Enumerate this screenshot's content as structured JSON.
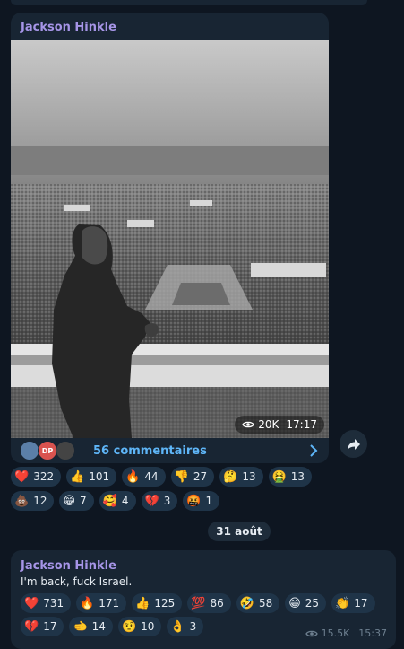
{
  "posts": [
    {
      "sender": "Jackson Hinkle",
      "image_icon": "photo-crowd-balcony",
      "views": "20K",
      "time": "17:17",
      "avatar_initials": "DP",
      "comments_label": "56 commentaires",
      "reactions": [
        {
          "emoji": "❤️",
          "count": "322"
        },
        {
          "emoji": "👍",
          "count": "101"
        },
        {
          "emoji": "🔥",
          "count": "44"
        },
        {
          "emoji": "👎",
          "count": "27"
        },
        {
          "emoji": "🤔",
          "count": "13"
        },
        {
          "emoji": "🤮",
          "count": "13"
        },
        {
          "emoji": "💩",
          "count": "12"
        },
        {
          "emoji": "😁",
          "count": "7"
        },
        {
          "emoji": "🥰",
          "count": "4"
        },
        {
          "emoji": "💔",
          "count": "3"
        },
        {
          "emoji": "🤬",
          "count": "1"
        }
      ]
    },
    {
      "sender": "Jackson Hinkle",
      "text": "I'm back, fuck Israel.",
      "views": "15.5K",
      "time": "15:37",
      "reactions": [
        {
          "emoji": "❤️",
          "count": "731"
        },
        {
          "emoji": "🔥",
          "count": "171"
        },
        {
          "emoji": "👍",
          "count": "125"
        },
        {
          "emoji": "💯",
          "count": "86"
        },
        {
          "emoji": "🤣",
          "count": "58"
        },
        {
          "emoji": "😁",
          "count": "25"
        },
        {
          "emoji": "👏",
          "count": "17"
        },
        {
          "emoji": "💔",
          "count": "17"
        },
        {
          "emoji": "🫲",
          "count": "14"
        },
        {
          "emoji": "🤨",
          "count": "10"
        },
        {
          "emoji": "👌",
          "count": "3"
        }
      ]
    }
  ],
  "date_separator": "31 août",
  "colors": {
    "background": "#0e1621",
    "bubble": "#182533",
    "sender": "#a695e7",
    "link": "#5eb5f7",
    "chip": "#1f3448"
  }
}
